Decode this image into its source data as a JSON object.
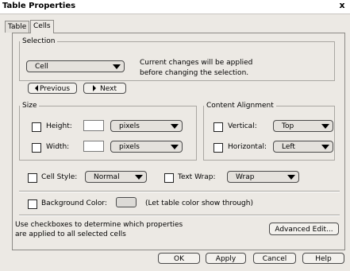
{
  "window": {
    "title": "Table Properties",
    "close_label": "x"
  },
  "tabs": [
    {
      "label": "Table"
    },
    {
      "label": "Cells"
    }
  ],
  "selection": {
    "legend": "Selection",
    "dropdown_value": "Cell",
    "note_line1": "Current changes will be applied",
    "note_line2": "before changing the selection.",
    "previous_label": "Previous",
    "next_label": "Next"
  },
  "size": {
    "legend": "Size",
    "height_label": "Height:",
    "height_unit": "pixels",
    "width_label": "Width:",
    "width_unit": "pixels"
  },
  "alignment": {
    "legend": "Content Alignment",
    "vertical_label": "Vertical:",
    "vertical_value": "Top",
    "horizontal_label": "Horizontal:",
    "horizontal_value": "Left"
  },
  "cell_style": {
    "label": "Cell Style:",
    "value": "Normal"
  },
  "text_wrap": {
    "label": "Text Wrap:",
    "value": "Wrap"
  },
  "background": {
    "label": "Background Color:",
    "note": "(Let table color show through)"
  },
  "hint": {
    "line1": "Use checkboxes to determine which properties",
    "line2": "are applied to all selected cells"
  },
  "buttons": {
    "advanced": "Advanced Edit...",
    "ok": "OK",
    "apply": "Apply",
    "cancel": "Cancel",
    "help": "Help"
  }
}
